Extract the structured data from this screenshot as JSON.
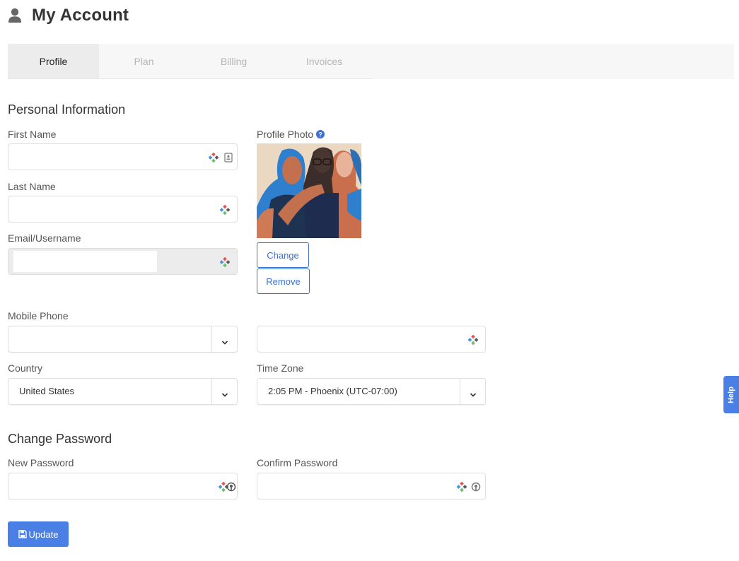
{
  "header": {
    "title": "My Account",
    "icon": "user-icon"
  },
  "tabs": [
    {
      "label": "Profile",
      "active": true
    },
    {
      "label": "Plan",
      "active": false
    },
    {
      "label": "Billing",
      "active": false
    },
    {
      "label": "Invoices",
      "active": false
    }
  ],
  "personal": {
    "heading": "Personal Information",
    "first_name": {
      "label": "First Name",
      "value": ""
    },
    "last_name": {
      "label": "Last Name",
      "value": ""
    },
    "email": {
      "label": "Email/Username",
      "value": ""
    },
    "profile_photo": {
      "label": "Profile Photo",
      "change_label": "Change",
      "remove_label": "Remove"
    },
    "mobile_phone": {
      "label": "Mobile Phone",
      "country_code": "",
      "number": ""
    },
    "country": {
      "label": "Country",
      "value": "United States"
    },
    "time_zone": {
      "label": "Time Zone",
      "value": "2:05 PM - Phoenix (UTC-07:00)"
    }
  },
  "password": {
    "heading": "Change Password",
    "new_label": "New Password",
    "confirm_label": "Confirm Password"
  },
  "actions": {
    "update_label": "Update"
  },
  "help": {
    "label": "Help"
  },
  "colors": {
    "accent": "#4a7fe6",
    "link": "#3b6fd4"
  }
}
